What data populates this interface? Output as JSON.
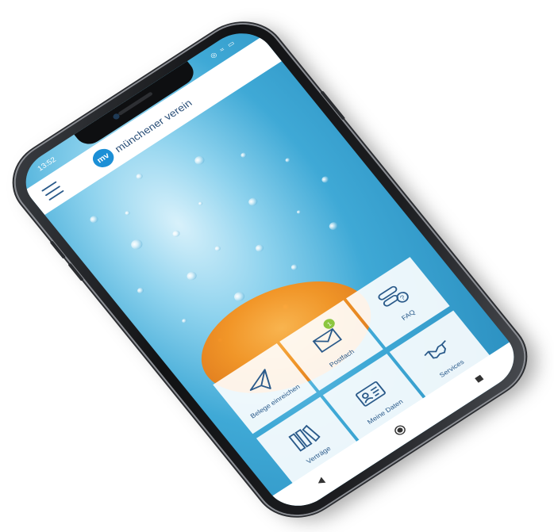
{
  "status": {
    "time": "13:52",
    "icons": "◎ ≈ ▭"
  },
  "app": {
    "logo_text": "mv",
    "name": "münchener verein"
  },
  "tiles": [
    {
      "label": "FAQ",
      "icon": "faq-icon"
    },
    {
      "label": "Postfach",
      "icon": "envelope-icon",
      "badge": "1"
    },
    {
      "label": "Belege einreichen",
      "icon": "paper-plane-icon"
    },
    {
      "label": "Services",
      "icon": "handshake-icon"
    },
    {
      "label": "Meine Daten",
      "icon": "id-card-icon"
    },
    {
      "label": "Verträge",
      "icon": "folders-icon"
    }
  ],
  "colors": {
    "brand_blue": "#1c8fd6",
    "text_blue": "#2a5a8a",
    "badge_green": "#8cc63f",
    "water_blue": "#3fa9d6",
    "orange": "#f7931e"
  },
  "navbar": [
    "back-icon",
    "home-icon",
    "recents-icon"
  ]
}
